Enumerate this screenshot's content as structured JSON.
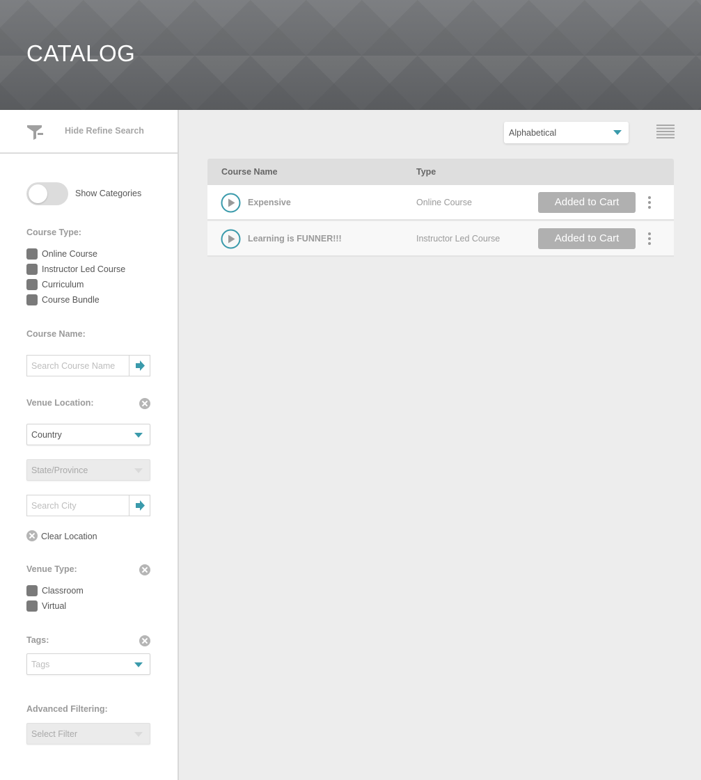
{
  "header": {
    "title": "CATALOG"
  },
  "sidebar": {
    "refine_toggle_label": "Hide Refine Search",
    "show_categories": {
      "label": "Show Categories",
      "on": false
    },
    "course_type": {
      "label": "Course Type:",
      "options": [
        "Online Course",
        "Instructor Led Course",
        "Curriculum",
        "Course Bundle"
      ]
    },
    "course_name": {
      "label": "Course Name:",
      "placeholder": "Search Course Name"
    },
    "venue_location": {
      "label": "Venue Location:",
      "country": "Country",
      "state": "State/Province",
      "city_placeholder": "Search City",
      "clear_label": "Clear Location"
    },
    "venue_type": {
      "label": "Venue Type:",
      "options": [
        "Classroom",
        "Virtual"
      ]
    },
    "tags": {
      "label": "Tags:",
      "placeholder": "Tags"
    },
    "advanced": {
      "label": "Advanced Filtering:",
      "placeholder": "Select Filter"
    }
  },
  "main": {
    "sort": {
      "selected": "Alphabetical"
    },
    "table": {
      "columns": [
        "Course Name",
        "Type"
      ],
      "rows": [
        {
          "name": "Expensive",
          "type": "Online Course",
          "action": "Added to Cart"
        },
        {
          "name": "Learning is FUNNER!!!",
          "type": "Instructor Led Course",
          "action": "Added to Cart"
        }
      ]
    }
  },
  "colors": {
    "accent": "#3a9aab",
    "button_gray": "#b0b0b0",
    "checkbox_gray": "#7a7a7a"
  },
  "icons": [
    "funnel-icon",
    "arrow-right-icon",
    "clear-icon",
    "caret-down-icon",
    "list-view-icon",
    "play-icon",
    "kebab-menu-icon"
  ]
}
